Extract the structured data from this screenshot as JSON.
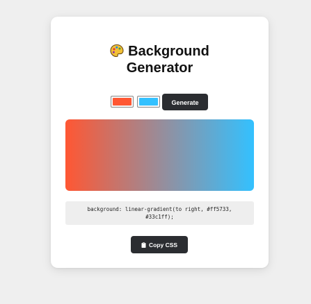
{
  "app": {
    "title": "Background Generator"
  },
  "header": {
    "icon": "palette-icon",
    "title": "Background Generator"
  },
  "controls": {
    "color1": "#ff5733",
    "color2": "#33c1ff",
    "generate_label": "Generate"
  },
  "preview": {
    "direction": "to right",
    "color1": "#ff5733",
    "color2": "#33c1ff"
  },
  "css_output": {
    "text": "background: linear-gradient(to right, #ff5733, #33c1ff);"
  },
  "copy_button": {
    "icon": "clipboard-icon",
    "label": "Copy CSS"
  }
}
